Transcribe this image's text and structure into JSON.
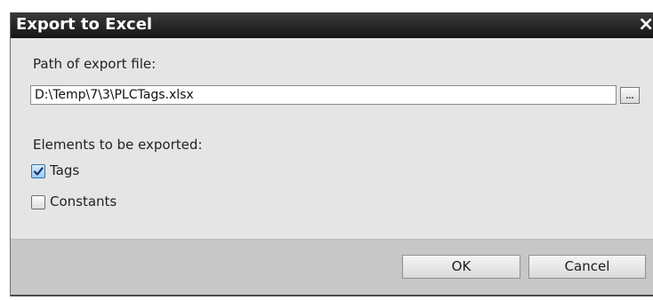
{
  "dialog": {
    "title": "Export to Excel",
    "close_glyph": "×"
  },
  "form": {
    "path_label": "Path of export file:",
    "path_value": "D:\\Temp\\7\\3\\PLCTags.xlsx",
    "browse_label": "...",
    "elements_label": "Elements to be exported:",
    "options": [
      {
        "label": "Tags",
        "checked": true
      },
      {
        "label": "Constants",
        "checked": false
      }
    ]
  },
  "buttons": {
    "ok_label": "OK",
    "cancel_label": "Cancel"
  },
  "colors": {
    "titlebar": "#1f1f1f",
    "body": "#e5e5e5",
    "footer": "#c7c7c7",
    "checkbox_checked": "#3d6fa8"
  },
  "icons": {
    "close": "close-icon",
    "check": "checkmark-icon"
  }
}
